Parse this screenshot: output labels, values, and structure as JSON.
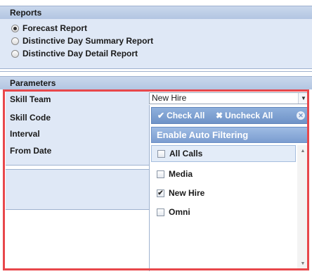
{
  "reports": {
    "title": "Reports",
    "options": [
      {
        "label": "Forecast Report",
        "selected": true
      },
      {
        "label": "Distinctive Day Summary Report",
        "selected": false
      },
      {
        "label": "Distinctive Day Detail Report",
        "selected": false
      }
    ]
  },
  "parameters": {
    "title": "Parameters",
    "fields": {
      "skill_team": "Skill Team",
      "skill_code": "Skill Code",
      "interval": "Interval",
      "from_date": "From Date"
    },
    "skill_team_value": "New Hire"
  },
  "dropdown": {
    "check_all": "Check All",
    "uncheck_all": "Uncheck All",
    "close_symbol": "✕",
    "auto_filter": "Enable Auto Filtering",
    "items": [
      {
        "label": "All Calls",
        "checked": false
      },
      {
        "label": "Media",
        "checked": false
      },
      {
        "label": "New Hire",
        "checked": true
      },
      {
        "label": "Omni",
        "checked": false
      }
    ]
  },
  "colors": {
    "panel_bg": "#dfe8f6",
    "header_bg": "#b3c6e2",
    "highlight_border": "#e8474b",
    "button_bar": "#7b9dd0"
  }
}
